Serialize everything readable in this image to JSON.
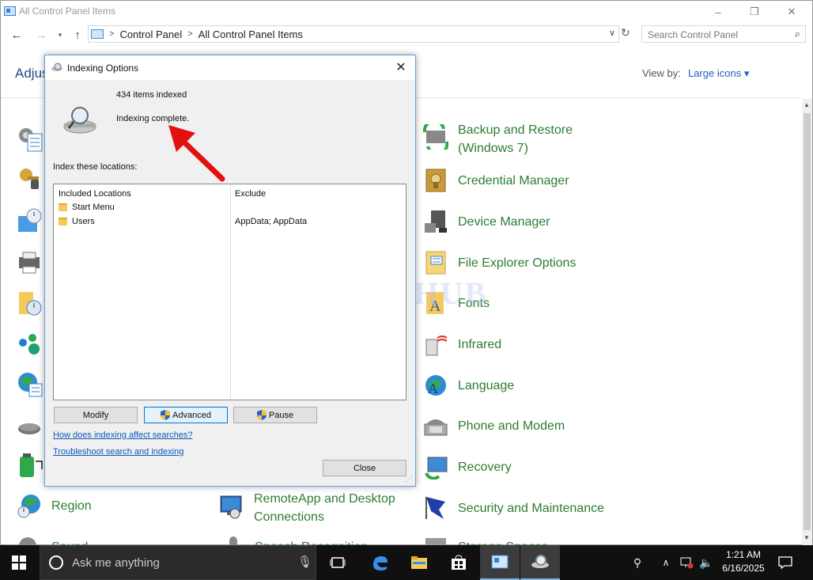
{
  "window": {
    "title": "All Control Panel Items",
    "controls": {
      "minimize": "–",
      "maximize": "❐",
      "close": "✕"
    }
  },
  "address": {
    "crumbs": [
      "Control Panel",
      "All Control Panel Items"
    ],
    "search_placeholder": "Search Control Panel"
  },
  "content": {
    "heading": "Adjus",
    "view_by_label": "View by:",
    "view_by_value": "Large icons ▾"
  },
  "items_right": [
    {
      "label": "Backup and Restore (Windows 7)",
      "icon": "backup-restore-icon"
    },
    {
      "label": "Credential Manager",
      "icon": "credential-manager-icon"
    },
    {
      "label": "Device Manager",
      "icon": "device-manager-icon"
    },
    {
      "label": "File Explorer Options",
      "icon": "file-explorer-options-icon"
    },
    {
      "label": "Fonts",
      "icon": "fonts-icon"
    },
    {
      "label": "Infrared",
      "icon": "infrared-icon"
    },
    {
      "label": "Language",
      "icon": "language-icon"
    },
    {
      "label": "Phone and Modem",
      "icon": "phone-modem-icon"
    },
    {
      "label": "Recovery",
      "icon": "recovery-icon"
    },
    {
      "label": "Security and Maintenance",
      "icon": "security-maintenance-icon"
    }
  ],
  "items_bottom": [
    {
      "label": "Region",
      "icon": "region-icon"
    },
    {
      "label": "RemoteApp and Desktop Connections",
      "icon": "remoteapp-icon"
    }
  ],
  "dialog": {
    "title": "Indexing Options",
    "items_indexed": "434 items indexed",
    "status": "Indexing complete.",
    "index_label": "Index these locations:",
    "table": {
      "col_included": "Included Locations",
      "col_exclude": "Exclude",
      "rows": [
        {
          "location": "Start Menu",
          "exclude": ""
        },
        {
          "location": "Users",
          "exclude": "AppData; AppData"
        }
      ]
    },
    "buttons": {
      "modify": "Modify",
      "advanced": "Advanced",
      "pause": "Pause",
      "close": "Close"
    },
    "links": {
      "how": "How does indexing affect searches?",
      "troubleshoot": "Troubleshoot search and indexing"
    }
  },
  "watermark": "IT Pros HUB",
  "taskbar": {
    "search_text": "Ask me anything",
    "time": "1:21 AM",
    "date": "6/16/2025"
  },
  "colors": {
    "accent": "#0078d7",
    "item_text": "#2e7d32",
    "link": "#0a5ab8",
    "arrow": "#e31010"
  }
}
